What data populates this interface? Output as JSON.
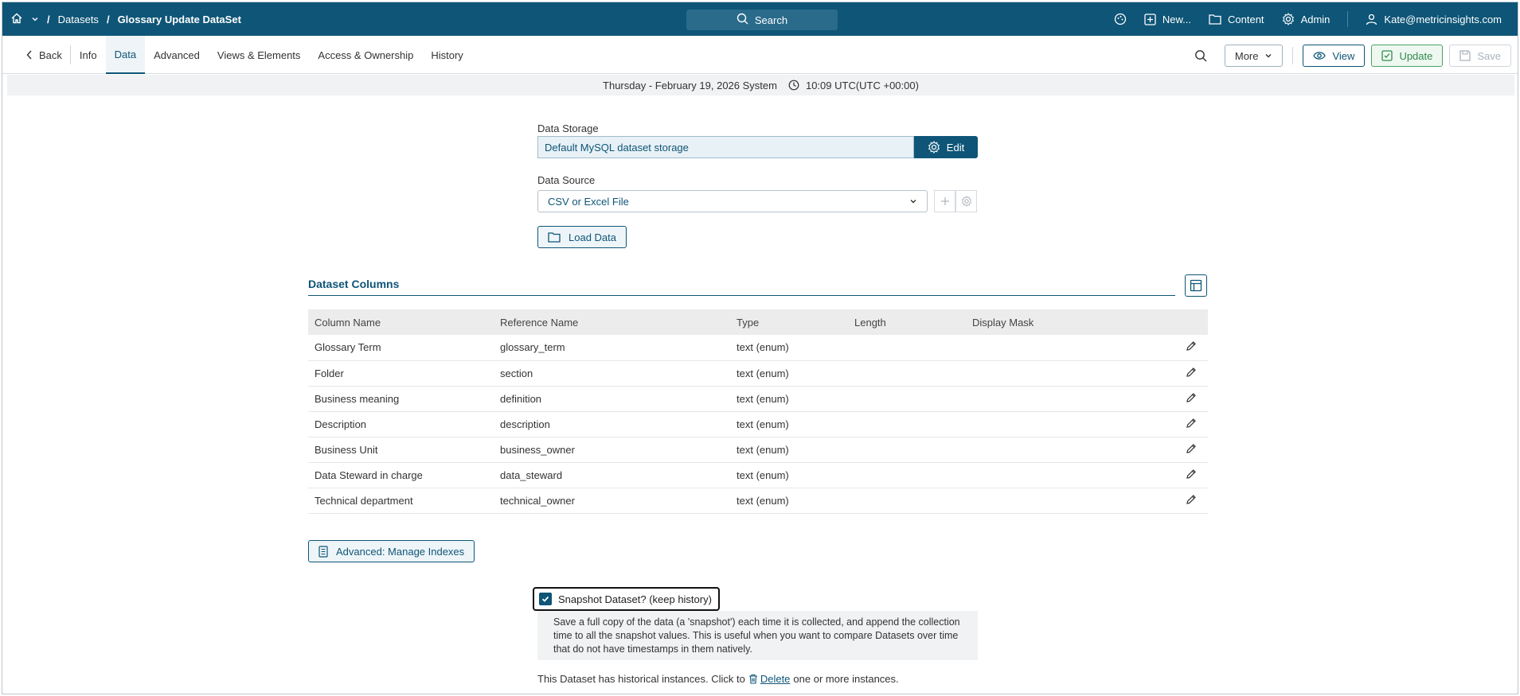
{
  "topbar": {
    "breadcrumb": [
      "Datasets",
      "Glossary Update DataSet"
    ],
    "search_label": "Search",
    "new_label": "New...",
    "content_label": "Content",
    "admin_label": "Admin",
    "user_email": "Kate@metricinsights.com"
  },
  "tabs": {
    "back": "Back",
    "items": [
      "Info",
      "Data",
      "Advanced",
      "Views & Elements",
      "Access & Ownership",
      "History"
    ],
    "active": "Data"
  },
  "toolbar": {
    "more_label": "More",
    "view_label": "View",
    "update_label": "Update",
    "save_label": "Save"
  },
  "datestrip": {
    "date": "Thursday - February 19, 2026 System",
    "time": "10:09 UTC(UTC +00:00)"
  },
  "storage": {
    "label": "Data Storage",
    "value": "Default MySQL dataset storage",
    "edit_label": "Edit"
  },
  "source": {
    "label": "Data Source",
    "value": "CSV or Excel File",
    "load_label": "Load Data"
  },
  "columns": {
    "title": "Dataset Columns",
    "headers": [
      "Column Name",
      "Reference Name",
      "Type",
      "Length",
      "Display Mask"
    ],
    "rows": [
      {
        "name": "Glossary Term",
        "ref": "glossary_term",
        "type": "text (enum)",
        "length": "",
        "mask": ""
      },
      {
        "name": "Folder",
        "ref": "section",
        "type": "text (enum)",
        "length": "",
        "mask": ""
      },
      {
        "name": "Business meaning",
        "ref": "definition",
        "type": "text (enum)",
        "length": "",
        "mask": ""
      },
      {
        "name": "Description",
        "ref": "description",
        "type": "text (enum)",
        "length": "",
        "mask": ""
      },
      {
        "name": "Business Unit",
        "ref": "business_owner",
        "type": "text (enum)",
        "length": "",
        "mask": ""
      },
      {
        "name": "Data Steward in charge",
        "ref": "data_steward",
        "type": "text (enum)",
        "length": "",
        "mask": ""
      },
      {
        "name": "Technical department",
        "ref": "technical_owner",
        "type": "text (enum)",
        "length": "",
        "mask": ""
      }
    ]
  },
  "advanced": {
    "manage_indexes_label": "Advanced: Manage Indexes"
  },
  "snapshot": {
    "label": "Snapshot Dataset? (keep history)",
    "checked": true,
    "description": "Save a full copy of the data (a 'snapshot') each time it is collected, and append the collection time to all the snapshot values. This is useful when you want to compare Datasets over time that do not have timestamps in them natively."
  },
  "history": {
    "prefix": "This Dataset has historical instances. Click to",
    "delete_label": "Delete",
    "suffix": "one or more instances."
  },
  "colors": {
    "brand": "#0e5577",
    "update_green": "#2f8a4b"
  }
}
